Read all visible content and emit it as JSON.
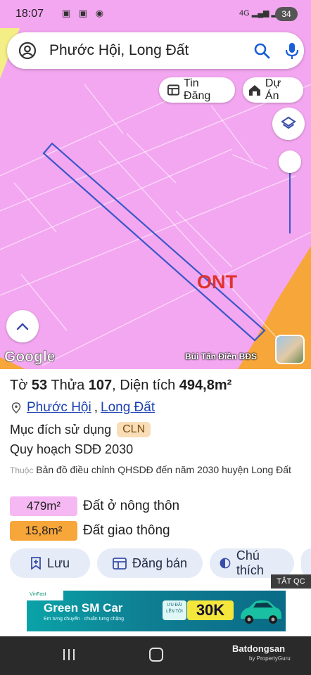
{
  "status_bar": {
    "time": "18:07",
    "notif_icons": "▣ ▣ ◉",
    "network": "4G",
    "battery": "34"
  },
  "search": {
    "query": "Phước Hội, Long Đất"
  },
  "map": {
    "chip_listings": "Tin Đăng",
    "chip_projects": "Dự Án",
    "zone_label": "ONT",
    "google_logo": "Google",
    "watermark": "Bùi Tấn Điền BĐS",
    "colors": {
      "residential_pink": "#f3a7f0",
      "transport_orange": "#f7a63a",
      "parcel_outline": "#3a57c9",
      "zone_label_red": "#e0322c"
    }
  },
  "parcel": {
    "title_sheet_label": "Tờ",
    "title_sheet_no": "53",
    "title_plot_label": "Thửa",
    "title_plot_no": "107",
    "title_area_label": ", Diện tích",
    "title_area_value": "494,8m²",
    "address_ward": "Phước Hội",
    "address_sep": ",",
    "address_district": "Long Đất",
    "purpose_label": "Mục đích sử dụng",
    "purpose_code": "CLN",
    "plan_title": "Quy hoạch SDĐ 2030",
    "source_prefix": "Thuộc",
    "source_text": "Bản đồ điều chỉnh QHSDĐ đến năm 2030 huyện Long Đất",
    "areas": [
      {
        "value": "479m²",
        "label": "Đất ở nông thôn"
      },
      {
        "value": "15,8m²",
        "label": "Đất giao thông"
      }
    ]
  },
  "actions": {
    "save": "Lưu",
    "post": "Đăng bán",
    "legend": "Chú thích"
  },
  "ad": {
    "close_label": "TẮT QC",
    "logo_strip": "VinFast",
    "brand": "Green SM Car",
    "tagline": "Em tưng chuyến · chuẩn tưng chặng",
    "offer_small": "ƯU ĐÃI LÊN TỚI",
    "offer": "30K"
  },
  "navbar": {
    "site_logo": "Batdongsan",
    "site_sub": "by PropertyGuru"
  }
}
